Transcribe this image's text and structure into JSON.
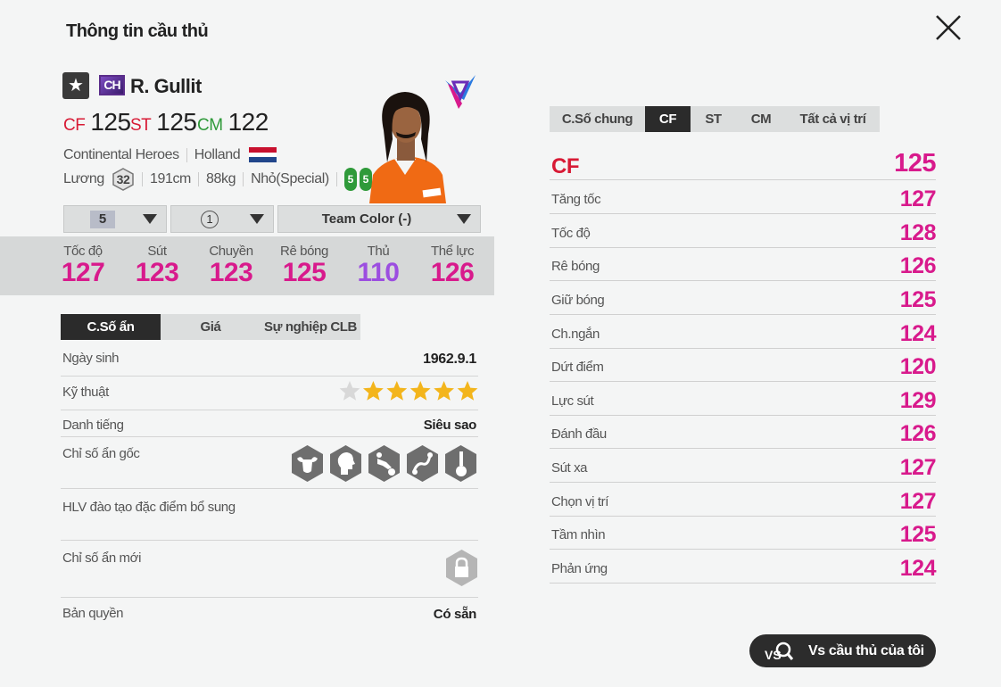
{
  "header": {
    "title": "Thông tin cầu thủ"
  },
  "player": {
    "season_badge": "CH",
    "name": "R. Gullit",
    "positions": [
      {
        "pos": "CF",
        "ovr": "125"
      },
      {
        "pos": "ST",
        "ovr": "125"
      },
      {
        "pos": "CM",
        "ovr": "122"
      }
    ],
    "season_name": "Continental Heroes",
    "nation": "Holland",
    "wage_label": "Lương",
    "wage": "32",
    "height": "191cm",
    "weight": "88kg",
    "body_type": "Nhỏ(Special)",
    "weak_foot_left": "5",
    "weak_foot_right": "5",
    "position_color": "#d81a35"
  },
  "selectors": {
    "upgrade_level": "5",
    "team_chem": "1",
    "team_color": "Team Color (-)"
  },
  "summary_stats": [
    {
      "name": "Tốc độ",
      "value": "127"
    },
    {
      "name": "Sút",
      "value": "123"
    },
    {
      "name": "Chuyền",
      "value": "123"
    },
    {
      "name": "Rê bóng",
      "value": "125"
    },
    {
      "name": "Thủ",
      "value": "110"
    },
    {
      "name": "Thể lực",
      "value": "126"
    }
  ],
  "left_tabs": [
    "C.Số ẩn",
    "Giá",
    "Sự nghiệp CLB"
  ],
  "details": {
    "birth_label": "Ngày sinh",
    "birth_value": "1962.9.1",
    "skill_label": "Kỹ thuật",
    "skill_stars": 5,
    "skill_max": 6,
    "fame_label": "Danh tiếng",
    "fame_value": "Siêu sao",
    "traits_label": "Chỉ số ẩn gốc",
    "traits_icons": [
      "bull-icon",
      "head-icon",
      "tackle-icon",
      "dribble-icon",
      "finesse-shot-icon"
    ],
    "coach_label": "HLV đào tạo đặc điểm bổ sung",
    "new_traits_label": "Chỉ số ẩn mới",
    "rights_label": "Bản quyền",
    "rights_value": "Có sẵn"
  },
  "right_tabs": [
    "C.Số chung",
    "CF",
    "ST",
    "CM",
    "Tất cả vị trí"
  ],
  "attributes": {
    "header": {
      "name": "CF",
      "value": "125"
    },
    "rows": [
      {
        "name": "Tăng tốc",
        "value": "127"
      },
      {
        "name": "Tốc độ",
        "value": "128"
      },
      {
        "name": "Rê bóng",
        "value": "126"
      },
      {
        "name": "Giữ bóng",
        "value": "125"
      },
      {
        "name": "Ch.ngắn",
        "value": "124"
      },
      {
        "name": "Dứt điểm",
        "value": "120"
      },
      {
        "name": "Lực sút",
        "value": "129"
      },
      {
        "name": "Đánh đầu",
        "value": "126"
      },
      {
        "name": "Sút xa",
        "value": "127"
      },
      {
        "name": "Chọn vị trí",
        "value": "127"
      },
      {
        "name": "Tầm nhìn",
        "value": "125"
      },
      {
        "name": "Phản ứng",
        "value": "124"
      }
    ]
  },
  "compare_button": {
    "label": "Vs cầu thủ của tôi"
  },
  "colors": {
    "stat_pink": "#d81a8c",
    "stat_purple": "#9c4ee0",
    "accent_red": "#d81a35"
  }
}
